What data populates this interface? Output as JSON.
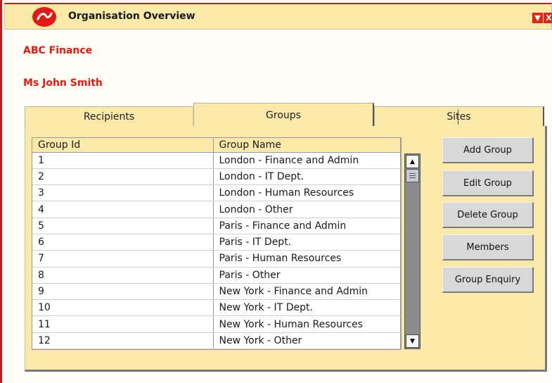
{
  "window": {
    "title": "Organisation Overview",
    "minimize_glyph": "▼",
    "close_glyph": "X"
  },
  "org": {
    "company": "ABC Finance",
    "contact": "Ms John Smith"
  },
  "tabs": [
    {
      "label": "Recipients",
      "active": false
    },
    {
      "label": "Groups",
      "active": true
    },
    {
      "label": "Sites",
      "active": false
    }
  ],
  "grid": {
    "columns": [
      "Group Id",
      "Group Name"
    ],
    "rows": [
      [
        "1",
        "London - Finance and Admin"
      ],
      [
        "2",
        "London - IT Dept."
      ],
      [
        "3",
        "London - Human Resources"
      ],
      [
        "4",
        "London - Other"
      ],
      [
        "5",
        "Paris - Finance and Admin"
      ],
      [
        "6",
        "Paris - IT Dept."
      ],
      [
        "7",
        "Paris - Human Resources"
      ],
      [
        "8",
        "Paris - Other"
      ],
      [
        "9",
        "New York - Finance and Admin"
      ],
      [
        "10",
        "New York - IT Dept."
      ],
      [
        "11",
        "New York - Human Resources"
      ],
      [
        "12",
        "New York - Other"
      ]
    ]
  },
  "scrollbar": {
    "up_glyph": "▲",
    "down_glyph": "▼"
  },
  "buttons": {
    "add": "Add Group",
    "edit": "Edit Group",
    "delete": "Delete Group",
    "members": "Members",
    "enquiry": "Group Enquiry"
  },
  "colors": {
    "brand_red": "#e8170f",
    "panel": "#fbe9aa",
    "button": "#d8d8d8"
  }
}
